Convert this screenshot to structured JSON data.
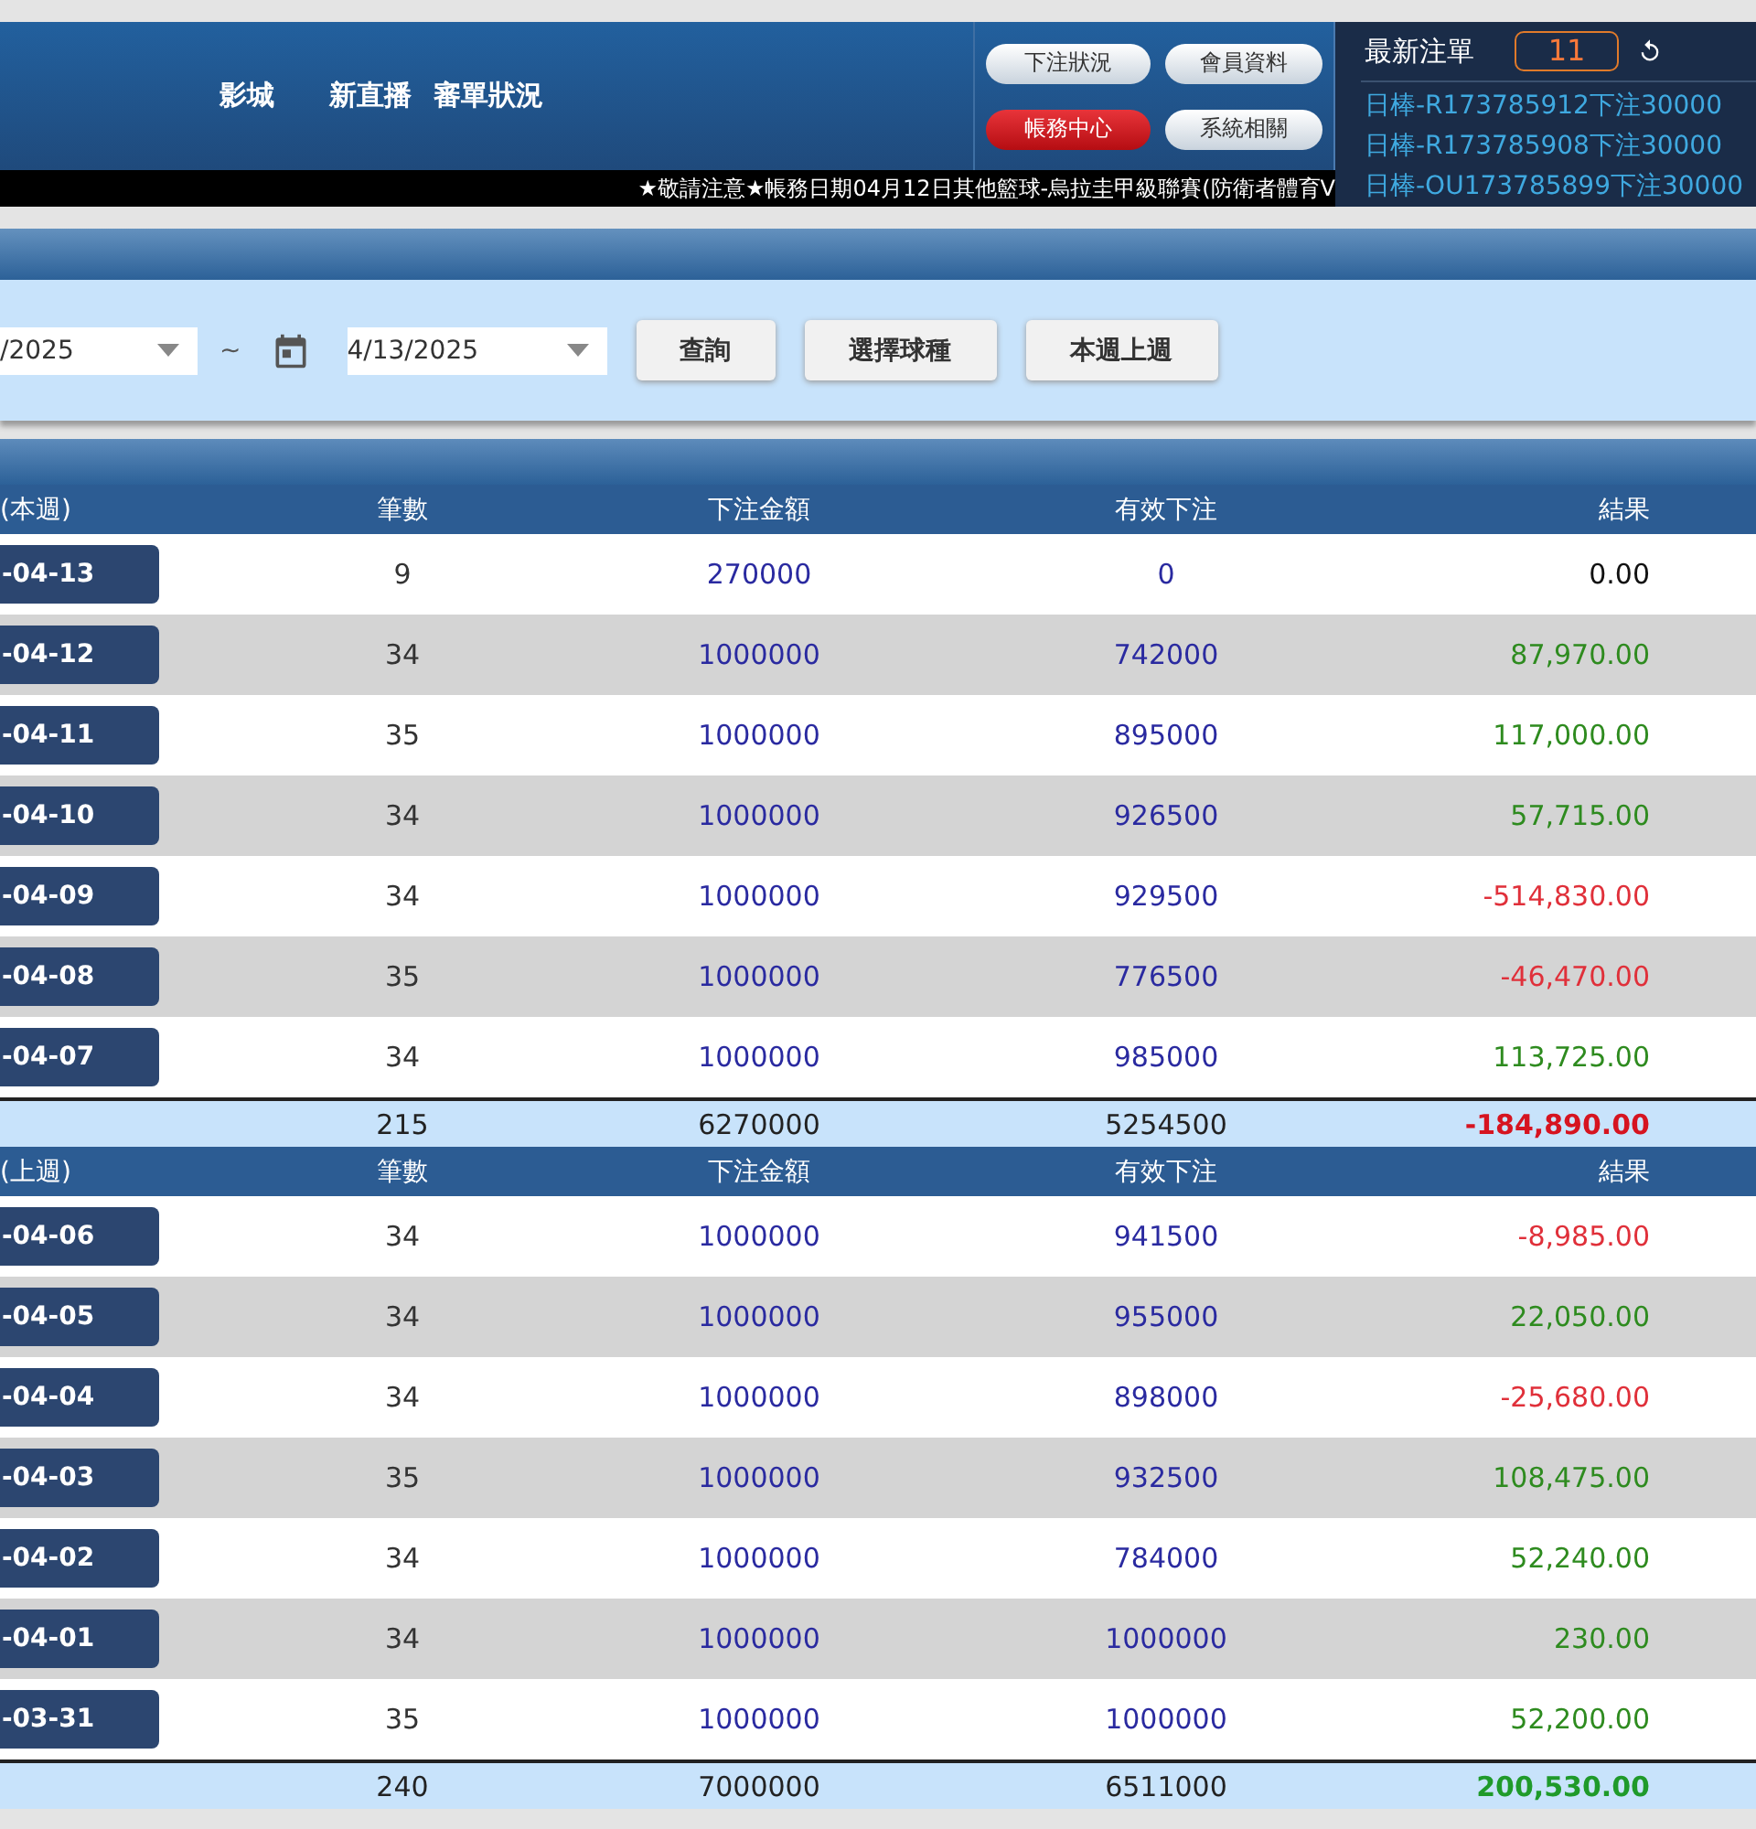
{
  "nav": {
    "links": [
      "影城",
      "新直播",
      "審單狀況"
    ],
    "buttons": [
      {
        "label": "下注狀況",
        "selected": false
      },
      {
        "label": "會員資料",
        "selected": false
      },
      {
        "label": "帳務中心",
        "selected": true
      },
      {
        "label": "系統相關",
        "selected": false
      }
    ],
    "ticker": "★敬請注意★帳務日期04月12日其他籃球-烏拉圭甲級聯賽(防衛者體育V"
  },
  "latest": {
    "title": "最新注單",
    "count": "11",
    "items": [
      "日棒-R173785912下注30000",
      "日棒-R173785908下注30000",
      "日棒-OU173785899下注30000"
    ]
  },
  "filter": {
    "from": "/2025",
    "separator": "~",
    "to": "4/13/2025",
    "buttons": [
      "查詢",
      "選擇球種",
      "本週上週"
    ]
  },
  "weeks": [
    {
      "columns": [
        "(本週)",
        "筆數",
        "下注金額",
        "有效下注",
        "結果"
      ],
      "rows": [
        {
          "date": "-04-13",
          "count": "9",
          "amount": "270000",
          "valid": "0",
          "result": "0.00",
          "color": "#111111"
        },
        {
          "date": "-04-12",
          "count": "34",
          "amount": "1000000",
          "valid": "742000",
          "result": "87,970.00",
          "color": "#2e8b1f"
        },
        {
          "date": "-04-11",
          "count": "35",
          "amount": "1000000",
          "valid": "895000",
          "result": "117,000.00",
          "color": "#2e8b1f"
        },
        {
          "date": "-04-10",
          "count": "34",
          "amount": "1000000",
          "valid": "926500",
          "result": "57,715.00",
          "color": "#2e8b1f"
        },
        {
          "date": "-04-09",
          "count": "34",
          "amount": "1000000",
          "valid": "929500",
          "result": "-514,830.00",
          "color": "#e0303a"
        },
        {
          "date": "-04-08",
          "count": "35",
          "amount": "1000000",
          "valid": "776500",
          "result": "-46,470.00",
          "color": "#e0303a"
        },
        {
          "date": "-04-07",
          "count": "34",
          "amount": "1000000",
          "valid": "985000",
          "result": "113,725.00",
          "color": "#2e8b1f"
        }
      ],
      "total": {
        "count": "215",
        "amount": "6270000",
        "valid": "5254500",
        "result": "-184,890.00",
        "color": "#d61420"
      }
    },
    {
      "columns": [
        "(上週)",
        "筆數",
        "下注金額",
        "有效下注",
        "結果"
      ],
      "rows": [
        {
          "date": "-04-06",
          "count": "34",
          "amount": "1000000",
          "valid": "941500",
          "result": "-8,985.00",
          "color": "#e0303a"
        },
        {
          "date": "-04-05",
          "count": "34",
          "amount": "1000000",
          "valid": "955000",
          "result": "22,050.00",
          "color": "#2e8b1f"
        },
        {
          "date": "-04-04",
          "count": "34",
          "amount": "1000000",
          "valid": "898000",
          "result": "-25,680.00",
          "color": "#e0303a"
        },
        {
          "date": "-04-03",
          "count": "35",
          "amount": "1000000",
          "valid": "932500",
          "result": "108,475.00",
          "color": "#2e8b1f"
        },
        {
          "date": "-04-02",
          "count": "34",
          "amount": "1000000",
          "valid": "784000",
          "result": "52,240.00",
          "color": "#2e8b1f"
        },
        {
          "date": "-04-01",
          "count": "34",
          "amount": "1000000",
          "valid": "1000000",
          "result": "230.00",
          "color": "#2e8b1f"
        },
        {
          "date": "-03-31",
          "count": "35",
          "amount": "1000000",
          "valid": "1000000",
          "result": "52,200.00",
          "color": "#2e8b1f"
        }
      ],
      "total": {
        "count": "240",
        "amount": "7000000",
        "valid": "6511000",
        "result": "200,530.00",
        "color": "#1f9a2a"
      }
    }
  ]
}
